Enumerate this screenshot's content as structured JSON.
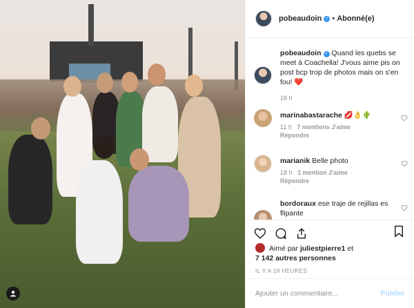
{
  "post": {
    "author": "pobeaudoin",
    "follow_status": "Abonné(e)",
    "separator": "•",
    "caption": "Quand les quebs se meet à Coachella! J'vous aime pis on post bcp trop de photos mais on s'en fou! ❤️",
    "caption_time": "18 h"
  },
  "comments": [
    {
      "user": "marinabastarache",
      "text": "💋👌🌵",
      "time": "11 h",
      "likes": "7 mentions J'aime",
      "reply": "Répondre"
    },
    {
      "user": "marianik",
      "text": "Belle photo",
      "time": "18 h",
      "likes": "1 mention J'aime",
      "reply": "Répondre"
    },
    {
      "user": "bordoraux",
      "text": "ese traje de rejillas es flipante"
    }
  ],
  "likes": {
    "prefix": "Aimé par",
    "first_user": "juliestpierre1",
    "connector": "et",
    "others": "7 142 autres personnes"
  },
  "timestamp": "IL Y A 18 HEURES",
  "add_comment": {
    "placeholder": "Ajouter un commentaire...",
    "publish": "Publier"
  },
  "colors": {
    "verified": "#3897f0",
    "heart": "#ed4956",
    "muted": "#8e8e8e",
    "publish_disabled": "#b3dbff"
  }
}
